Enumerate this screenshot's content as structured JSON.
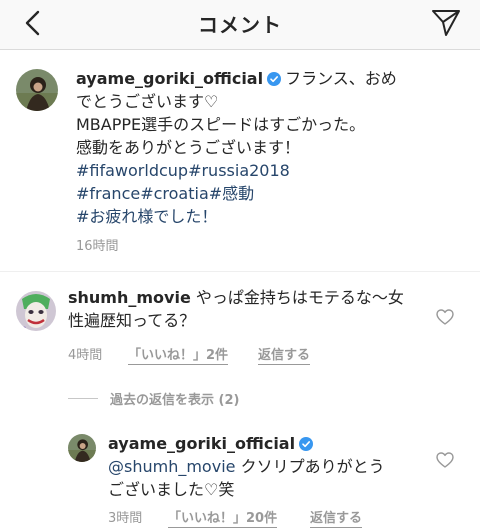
{
  "header": {
    "title": "コメント",
    "back_icon": "chevron-left-icon",
    "send_icon": "paper-plane-icon"
  },
  "caption": {
    "username": "ayame_goriki_official",
    "verified": true,
    "lines": [
      "フランス、おめ",
      "でとうございます♡",
      "MBAPPE選手のスピードはすごかった。",
      "感動をありがとうございます！"
    ],
    "hashtag_lines": [
      "#fifaworldcup#russia2018",
      "#france#croatia#感動",
      "#お疲れ様でした！"
    ],
    "time": "16時間"
  },
  "comments": [
    {
      "username": "shumh_movie",
      "text_line1": "やっぱ金持ちはモテるな〜女",
      "text_line2": "性遍歴知ってる？",
      "time": "4時間",
      "likes": "「いいね！」2件",
      "reply": "返信する"
    }
  ],
  "view_replies": "過去の返信を表示 (2)",
  "reply": {
    "username": "ayame_goriki_official",
    "verified": true,
    "mention": "@shumh_movie",
    "text_line1": " クソリプありがとう",
    "text_line2": "ございました♡笑",
    "time": "3時間",
    "likes": "「いいね！」20件",
    "reply": "返信する"
  },
  "colors": {
    "hashtag": "#27466b",
    "verified": "#3897f0",
    "meta": "#999999",
    "text": "#262626"
  }
}
